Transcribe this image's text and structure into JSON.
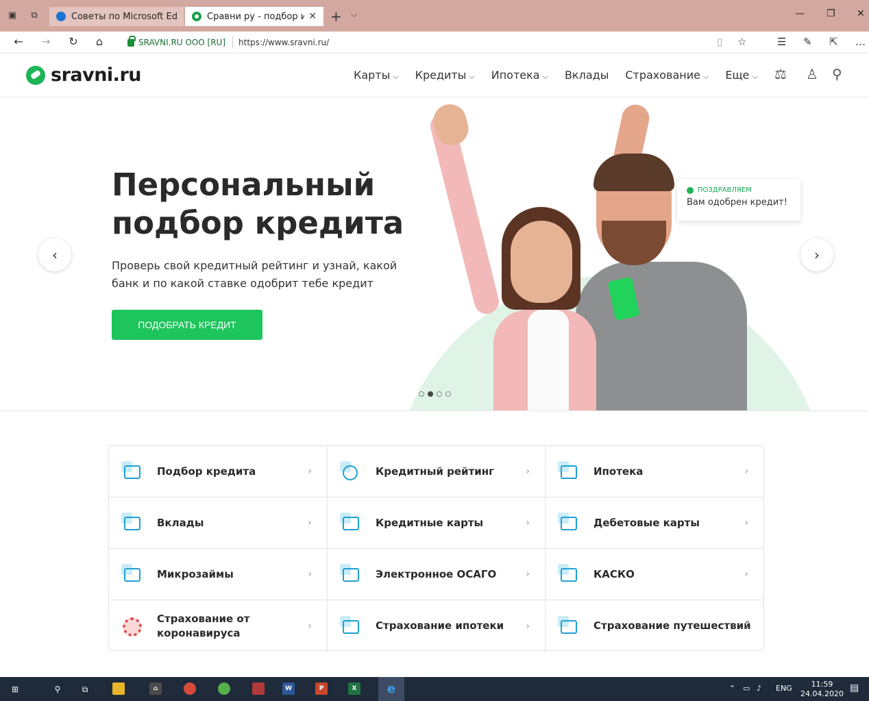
{
  "browser": {
    "tabs": [
      {
        "label": "Советы по Microsoft Edge",
        "active": false
      },
      {
        "label": "Сравни ру - подбор и с",
        "active": true
      }
    ],
    "new_tab": "+",
    "address": {
      "certificate": "SRAVNI.RU OOO [RU]",
      "url": "https://www.sravni.ru/"
    }
  },
  "site": {
    "logo": "sravni.ru",
    "nav": [
      {
        "label": "Карты",
        "dropdown": true
      },
      {
        "label": "Кредиты",
        "dropdown": true
      },
      {
        "label": "Ипотека",
        "dropdown": true
      },
      {
        "label": "Вклады",
        "dropdown": false
      },
      {
        "label": "Страхование",
        "dropdown": true
      },
      {
        "label": "Еще",
        "dropdown": true
      }
    ],
    "chevron_glyph": "⌄"
  },
  "hero": {
    "title_line1": "Персональный",
    "title_line2": "подбор кредита",
    "subtitle": "Проверь свой кредитный рейтинг и узнай, какой банк и по какой ставке одобрит тебе кредит",
    "cta": "ПОДОБРАТЬ КРЕДИТ",
    "prev": "‹",
    "next": "›",
    "slides_total": 4,
    "slide_active": 2,
    "card_tag": "ПОЗДРАВЛЯЕМ",
    "card_text": "Вам одобрен кредит!",
    "accent": "#1ec45c"
  },
  "services": [
    {
      "label": "Подбор кредита",
      "icon": "wallet-icon"
    },
    {
      "label": "Кредитный рейтинг",
      "icon": "speedometer-icon"
    },
    {
      "label": "Ипотека",
      "icon": "building-icon"
    },
    {
      "label": "Вклады",
      "icon": "safe-icon"
    },
    {
      "label": "Кредитные карты",
      "icon": "credit-card-icon"
    },
    {
      "label": "Дебетовые карты",
      "icon": "debit-card-icon"
    },
    {
      "label": "Микрозаймы",
      "icon": "cash-icon"
    },
    {
      "label": "Электронное ОСАГО",
      "icon": "document-icon"
    },
    {
      "label": "КАСКО",
      "icon": "car-icon"
    },
    {
      "label": "Страхование от коронавируса",
      "icon": "virus-icon"
    },
    {
      "label": "Страхование ипотеки",
      "icon": "building-icon"
    },
    {
      "label": "Страхование путешествий",
      "icon": "mountain-icon"
    }
  ],
  "taskbar": {
    "lang": "ENG",
    "time": "11:59",
    "date": "24.04.2020"
  }
}
